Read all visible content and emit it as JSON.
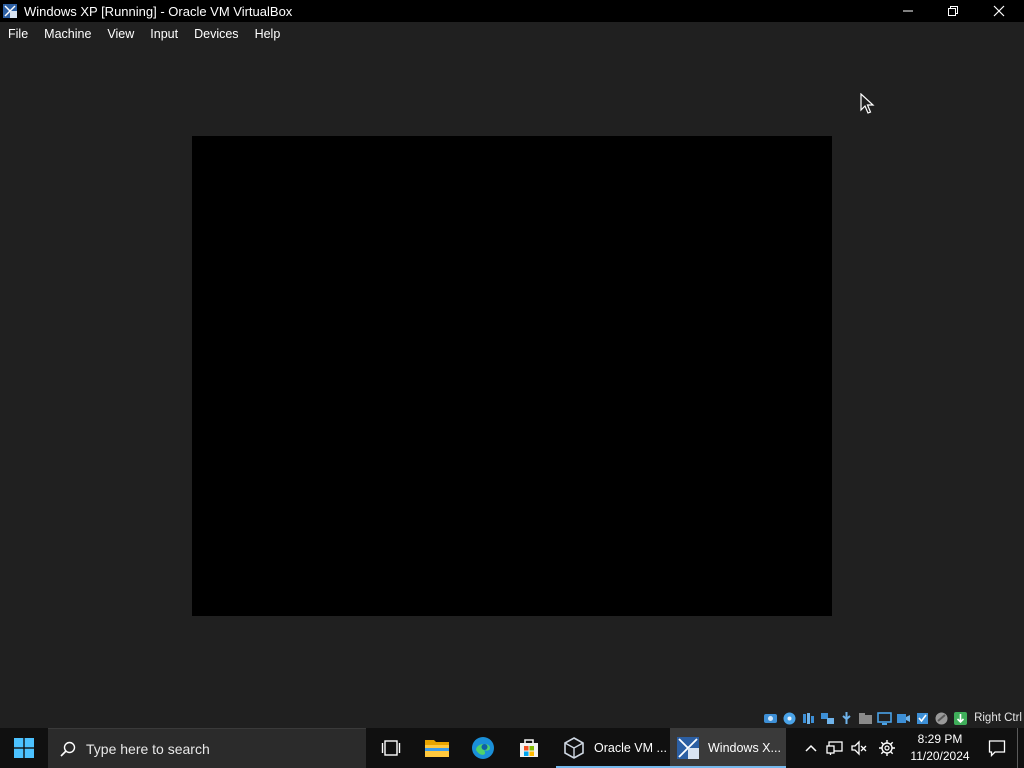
{
  "window": {
    "title": "Windows XP [Running] - Oracle VM VirtualBox",
    "app_icon": "virtualbox-xp-icon",
    "controls": [
      "minimize-icon",
      "restore-icon",
      "close-icon"
    ]
  },
  "menu": {
    "items": [
      {
        "label": "File"
      },
      {
        "label": "Machine"
      },
      {
        "label": "View"
      },
      {
        "label": "Input"
      },
      {
        "label": "Devices"
      },
      {
        "label": "Help"
      }
    ]
  },
  "vm": {
    "screen_color": "#000000"
  },
  "statusbar": {
    "icons": [
      "hard-disk-icon",
      "optical-drive-icon",
      "audio-icon",
      "network-icon",
      "usb-icon",
      "shared-folder-icon",
      "display-icon",
      "recording-icon",
      "cpu-icon",
      "mouse-integration-icon",
      "keyboard-icon"
    ],
    "host_key": "Right Ctrl"
  },
  "taskbar": {
    "search_placeholder": "Type here to search",
    "pinned": [
      "task-view-icon",
      "file-explorer-icon",
      "edge-icon",
      "store-icon"
    ],
    "apps": [
      {
        "label": "Oracle VM ...",
        "icon": "virtualbox-icon",
        "active": false
      },
      {
        "label": "Windows X...",
        "icon": "virtualbox-xp-icon",
        "active": true
      }
    ],
    "tray_icons": [
      "chevron-up-icon",
      "network-icon",
      "volume-muted-icon",
      "settings-gear-icon"
    ],
    "clock": {
      "time": "8:29 PM",
      "date": "11/20/2024"
    },
    "notification_icon": "action-center-icon",
    "accent": "#76b9ed"
  }
}
